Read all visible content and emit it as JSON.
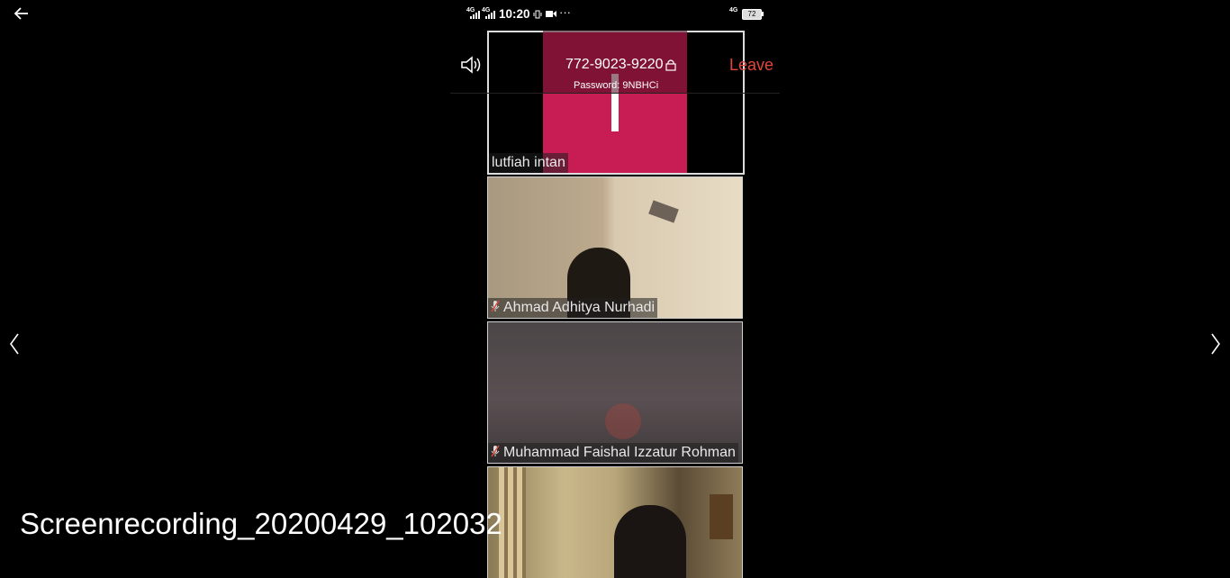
{
  "viewer": {
    "filename": "Screenrecording_20200429_102032"
  },
  "status_bar": {
    "time": "10:20",
    "network_left_1": "4G",
    "network_left_2": "4G",
    "network_right": "4G",
    "battery": "72",
    "more": "···"
  },
  "meeting": {
    "id": "772-9023-9220",
    "password": "Password: 9NBHCi",
    "leave_label": "Leave"
  },
  "participants": [
    {
      "name": "lutfiah intan",
      "muted": false
    },
    {
      "name": "Ahmad Adhitya Nurhadi",
      "muted": true
    },
    {
      "name": "Muhammad Faishal Izzatur Rohman",
      "muted": true
    },
    {
      "name": "",
      "muted": false
    }
  ],
  "colors": {
    "accent_leave": "#e2463c",
    "avatar_pink": "#c81d54",
    "background": "#000000"
  },
  "icons": {
    "back": "arrow-left-icon",
    "prev": "chevron-left-icon",
    "next": "chevron-right-icon",
    "speaker": "speaker-icon",
    "lock": "lock-icon",
    "mic_muted": "mic-muted-icon"
  }
}
